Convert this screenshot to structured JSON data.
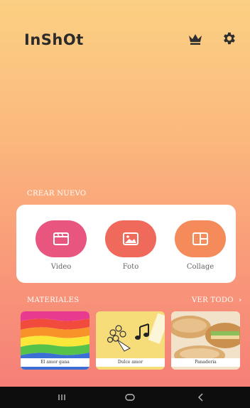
{
  "app": {
    "logo": "InShOt"
  },
  "header": {
    "premium_icon": "crown-icon",
    "settings_icon": "gear-icon"
  },
  "create": {
    "heading": "CREAR NUEVO",
    "buttons": [
      {
        "label": "Video",
        "icon": "clapperboard-icon",
        "color": "#e8557e"
      },
      {
        "label": "Foto",
        "icon": "image-icon",
        "color": "#ef6a5a"
      },
      {
        "label": "Collage",
        "icon": "layout-icon",
        "color": "#f58a5a"
      }
    ]
  },
  "materials": {
    "heading": "MATERIALES",
    "see_all": "VER TODO",
    "items": [
      {
        "caption": "El amor gana"
      },
      {
        "caption": "Dulce amor"
      },
      {
        "caption": "Panaderia"
      }
    ]
  },
  "nav": {
    "recent_icon": "recent-apps-icon",
    "home_icon": "home-icon",
    "back_icon": "back-icon"
  },
  "colors": {
    "bg_top": "#fbd083",
    "bg_bottom": "#f57f78",
    "card": "#ffffff",
    "navbar": "#0d0d0d"
  }
}
